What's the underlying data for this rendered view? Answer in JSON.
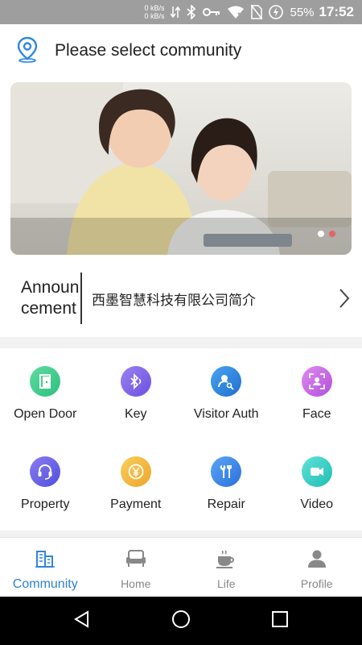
{
  "status_bar": {
    "speed_up": "0 kB/s",
    "speed_down": "0 kB/s",
    "battery": "55%",
    "time": "17:52"
  },
  "header": {
    "title": "Please select community",
    "icon": "location-pin-icon"
  },
  "banner": {
    "slides": 2,
    "active_slide": 2
  },
  "announcement": {
    "label": "Announcement",
    "text": "西墨智慧科技有限公司简介"
  },
  "services": [
    {
      "label": "Open Door",
      "icon": "door-icon",
      "color": "#3ec98c"
    },
    {
      "label": "Key",
      "icon": "bluetooth-icon",
      "color": "#7a63e6"
    },
    {
      "label": "Visitor Auth",
      "icon": "visitor-key-icon",
      "color": "#2e86e0"
    },
    {
      "label": "Face",
      "icon": "face-scan-icon",
      "color": "#c25fe0"
    },
    {
      "label": "Property",
      "icon": "headset-icon",
      "color": "#6a5be0"
    },
    {
      "label": "Payment",
      "icon": "yen-icon",
      "color": "#f0b23a"
    },
    {
      "label": "Repair",
      "icon": "wrench-icon",
      "color": "#3a86e6"
    },
    {
      "label": "Video",
      "icon": "video-camera-icon",
      "color": "#2ed0c6"
    }
  ],
  "tabs": [
    {
      "label": "Community",
      "icon": "building-icon",
      "active": true
    },
    {
      "label": "Home",
      "icon": "sofa-icon",
      "active": false
    },
    {
      "label": "Life",
      "icon": "coffee-cup-icon",
      "active": false
    },
    {
      "label": "Profile",
      "icon": "person-icon",
      "active": false
    }
  ],
  "colors": {
    "accent": "#2f7fd6",
    "status_bar": "#9e9e9e",
    "banner_dot_active": "#e06666"
  }
}
